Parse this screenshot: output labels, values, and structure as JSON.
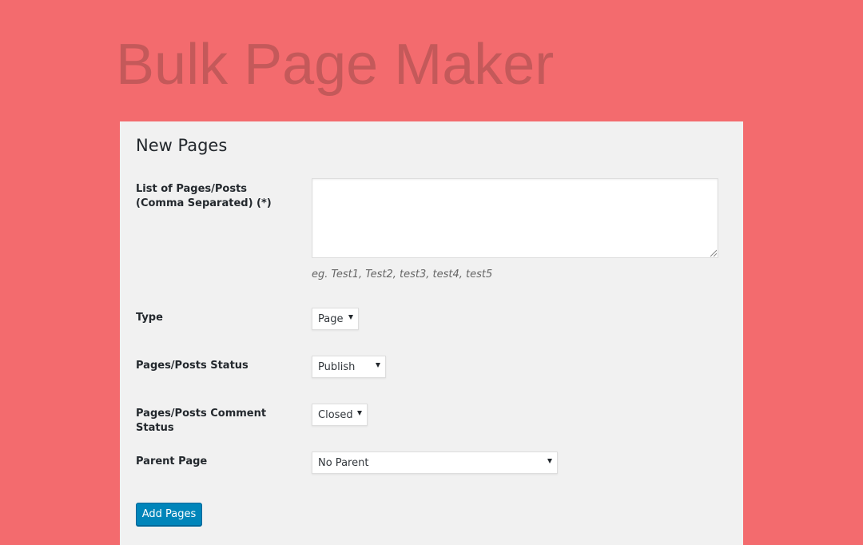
{
  "app": {
    "title": "Bulk Page Maker"
  },
  "form": {
    "heading": "New Pages",
    "pages_list": {
      "label_line1": "List of Pages/Posts",
      "label_line2": "(Comma Separated) (*)",
      "value": "",
      "hint": "eg. Test1, Test2, test3, test4, test5"
    },
    "type": {
      "label": "Type",
      "value": "Page"
    },
    "status": {
      "label": "Pages/Posts Status",
      "value": "Publish"
    },
    "comment_status": {
      "label": "Pages/Posts Comment Status",
      "value": "Closed"
    },
    "parent": {
      "label": "Parent Page",
      "value": "No Parent"
    },
    "submit_label": "Add Pages"
  },
  "colors": {
    "background": "#f36b6e",
    "title_text": "#c4595a",
    "panel": "#f1f1f1",
    "primary_button": "#0085ba"
  }
}
